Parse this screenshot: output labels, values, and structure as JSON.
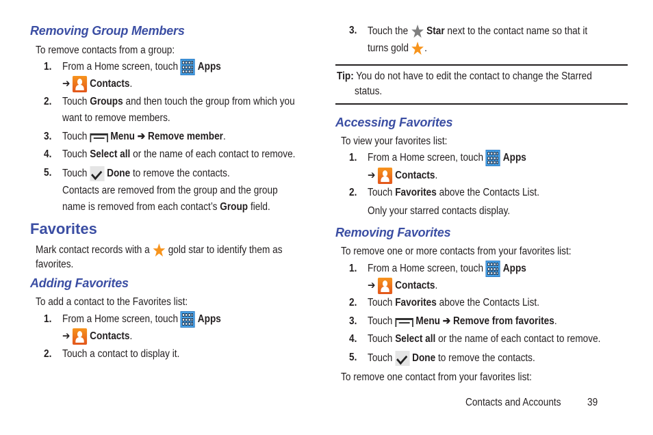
{
  "icons": {
    "apps": "apps-grid-icon",
    "contacts": "contacts-icon",
    "menu": "menu-icon",
    "done": "checkmark-icon",
    "star_gold": "gold-star-icon",
    "star_gray": "gray-star-icon",
    "arrow": "➔"
  },
  "colors": {
    "heading": "#3b4ea3",
    "gold_star": "#f7941d",
    "gray_star": "#7f7f7f",
    "apps_blue": "#4aa3e8"
  },
  "left": {
    "removing_group": {
      "title": "Removing Group Members",
      "intro": "To remove contacts from a group:",
      "steps": [
        {
          "num": "1.",
          "pre": "From a Home screen, touch",
          "apps": "Apps",
          "contacts": "Contacts",
          "period": "."
        },
        {
          "num": "2.",
          "pre": "Touch",
          "bold": "Groups",
          "post": "and then touch the group from which you",
          "line2": "want to remove members."
        },
        {
          "num": "3.",
          "pre": "Touch",
          "menu": "Menu",
          "bold2": "Remove member",
          "period": "."
        },
        {
          "num": "4.",
          "pre": "Touch",
          "bold": "Select all",
          "post": "or the name of each contact to remove."
        },
        {
          "num": "5.",
          "pre": "Touch",
          "bold": "Done",
          "post": "to remove the contacts."
        }
      ],
      "note_line1": "Contacts are removed from the group and the group",
      "note_line2_pre": "name is removed from each contact’s",
      "note_line2_bold": "Group",
      "note_line2_post": "field."
    },
    "favorites": {
      "title": "Favorites",
      "line1_pre": "Mark contact records with a",
      "line1_post": "gold star to identify them as",
      "line2": "favorites."
    },
    "adding": {
      "title": "Adding Favorites",
      "intro": "To add a contact to the Favorites list:",
      "steps": [
        {
          "num": "1.",
          "pre": "From a Home screen, touch",
          "apps": "Apps",
          "contacts": "Contacts",
          "period": "."
        },
        {
          "num": "2.",
          "text": "Touch a contact to display it."
        }
      ]
    }
  },
  "right": {
    "adding_cont": {
      "step3": {
        "num": "3.",
        "pre": "Touch the",
        "bold": "Star",
        "post": "next to the contact name so that it",
        "line2": "turns gold",
        "period": "."
      }
    },
    "tip": {
      "label": "Tip:",
      "text": "You do not have to edit the contact to change the Starred",
      "line2": "status."
    },
    "accessing": {
      "title": "Accessing Favorites",
      "intro": "To view your favorites list:",
      "steps": [
        {
          "num": "1.",
          "pre": "From a Home screen, touch",
          "apps": "Apps",
          "contacts": "Contacts",
          "period": "."
        },
        {
          "num": "2.",
          "pre": "Touch",
          "bold": "Favorites",
          "post": "above the Contacts List."
        }
      ],
      "note": "Only your starred contacts display."
    },
    "removing_fav": {
      "title": "Removing Favorites",
      "intro": "To remove one or more contacts from your favorites list:",
      "steps": [
        {
          "num": "1.",
          "pre": "From a Home screen, touch",
          "apps": "Apps",
          "contacts": "Contacts",
          "period": "."
        },
        {
          "num": "2.",
          "pre": "Touch",
          "bold": "Favorites",
          "post": "above the Contacts List."
        },
        {
          "num": "3.",
          "pre": "Touch",
          "menu": "Menu",
          "bold2": "Remove from favorites",
          "period": "."
        },
        {
          "num": "4.",
          "pre": "Touch",
          "bold": "Select all",
          "post": "or the name of each contact to remove."
        },
        {
          "num": "5.",
          "pre": "Touch",
          "bold": "Done",
          "post": "to remove the contacts."
        }
      ],
      "outro": "To remove one contact from your favorites list:"
    }
  },
  "footer": {
    "section": "Contacts and Accounts",
    "page": "39"
  }
}
